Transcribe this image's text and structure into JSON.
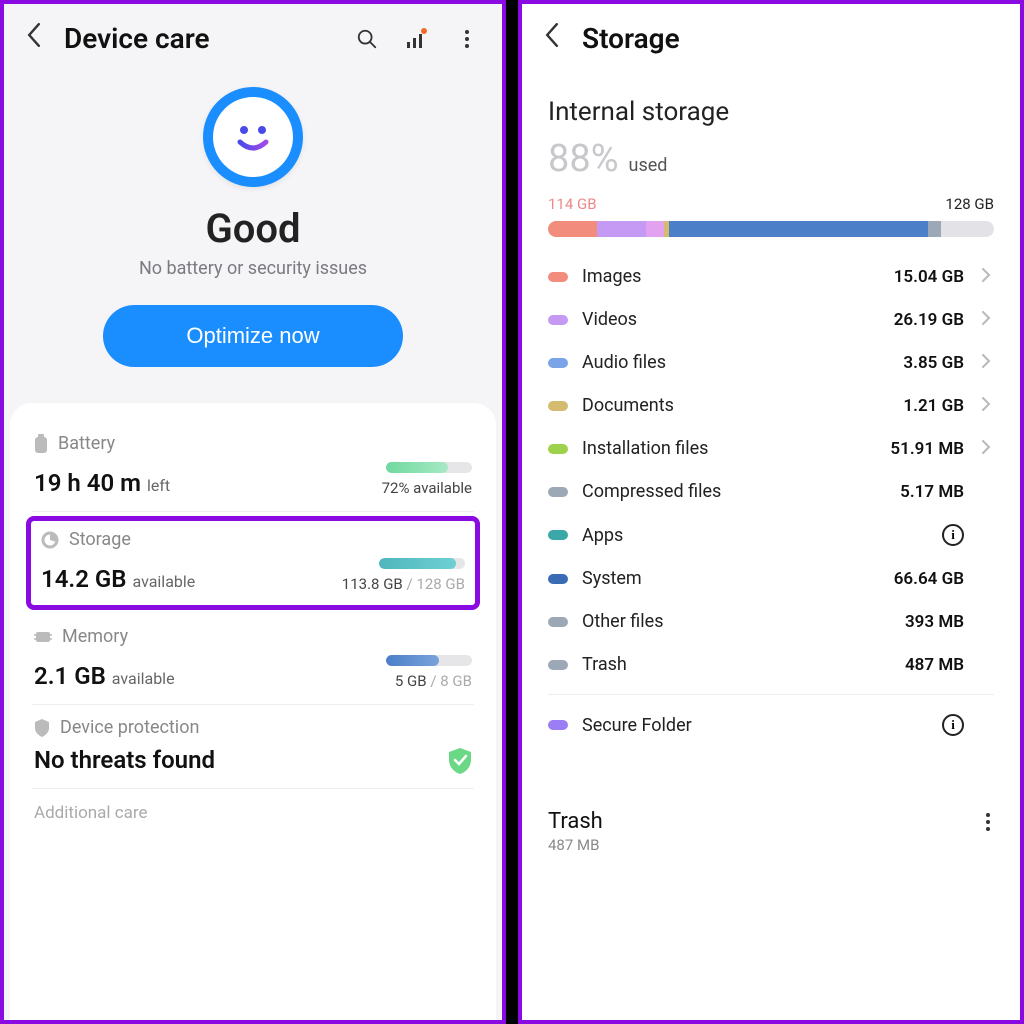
{
  "left": {
    "title": "Device care",
    "status": {
      "headline": "Good",
      "sub": "No battery or security issues",
      "button": "Optimize now"
    },
    "battery": {
      "label": "Battery",
      "value": "19 h 40 m",
      "unit": "left",
      "right": "72% available",
      "bar_pct": 72,
      "bar_color": "linear-gradient(90deg,#6fd99e,#a7e9c5)"
    },
    "storage": {
      "label": "Storage",
      "value": "14.2 GB",
      "unit": "available",
      "used": "113.8 GB",
      "total": "128 GB",
      "bar_pct": 89,
      "bar_color": "linear-gradient(90deg,#4fb6bd,#6ed0d3)"
    },
    "memory": {
      "label": "Memory",
      "value": "2.1 GB",
      "unit": "available",
      "used": "5 GB",
      "total": "8 GB",
      "bar_pct": 62,
      "bar_color": "linear-gradient(90deg,#4b7fc8,#7aa3db)"
    },
    "protection": {
      "label": "Device protection",
      "value": "No threats found"
    },
    "additional": "Additional care"
  },
  "right": {
    "title": "Storage",
    "section": "Internal storage",
    "pct": "88%",
    "pct_label": "used",
    "used_label": "114 GB",
    "total_label": "128 GB",
    "bar_segments": [
      {
        "color": "#f28d7e",
        "pct": 11
      },
      {
        "color": "#c49af5",
        "pct": 11
      },
      {
        "color": "#e3a2f0",
        "pct": 4
      },
      {
        "color": "#d4bb70",
        "pct": 1.2
      },
      {
        "color": "#4b7fc8",
        "pct": 58
      },
      {
        "color": "#9ca8b5",
        "pct": 3
      }
    ],
    "categories": [
      {
        "color": "#f28d7e",
        "label": "Images",
        "size": "15.04 GB",
        "chev": true
      },
      {
        "color": "#c49af5",
        "label": "Videos",
        "size": "26.19 GB",
        "chev": true
      },
      {
        "color": "#7aa3e8",
        "label": "Audio files",
        "size": "3.85 GB",
        "chev": true
      },
      {
        "color": "#d4bb70",
        "label": "Documents",
        "size": "1.21 GB",
        "chev": true
      },
      {
        "color": "#9ed24a",
        "label": "Installation files",
        "size": "51.91 MB",
        "chev": true
      },
      {
        "color": "#9ca8b5",
        "label": "Compressed files",
        "size": "5.17 MB",
        "chev": false
      },
      {
        "color": "#3aa8a8",
        "label": "Apps",
        "size": "",
        "info": true
      },
      {
        "color": "#3a6bb5",
        "label": "System",
        "size": "66.64 GB",
        "chev": false
      },
      {
        "color": "#9ca8b5",
        "label": "Other files",
        "size": "393 MB",
        "chev": false
      },
      {
        "color": "#9ca8b5",
        "label": "Trash",
        "size": "487 MB",
        "chev": false
      }
    ],
    "secure_folder": {
      "color": "#9b7ef5",
      "label": "Secure Folder"
    },
    "trash": {
      "title": "Trash",
      "sub": "487 MB"
    }
  }
}
